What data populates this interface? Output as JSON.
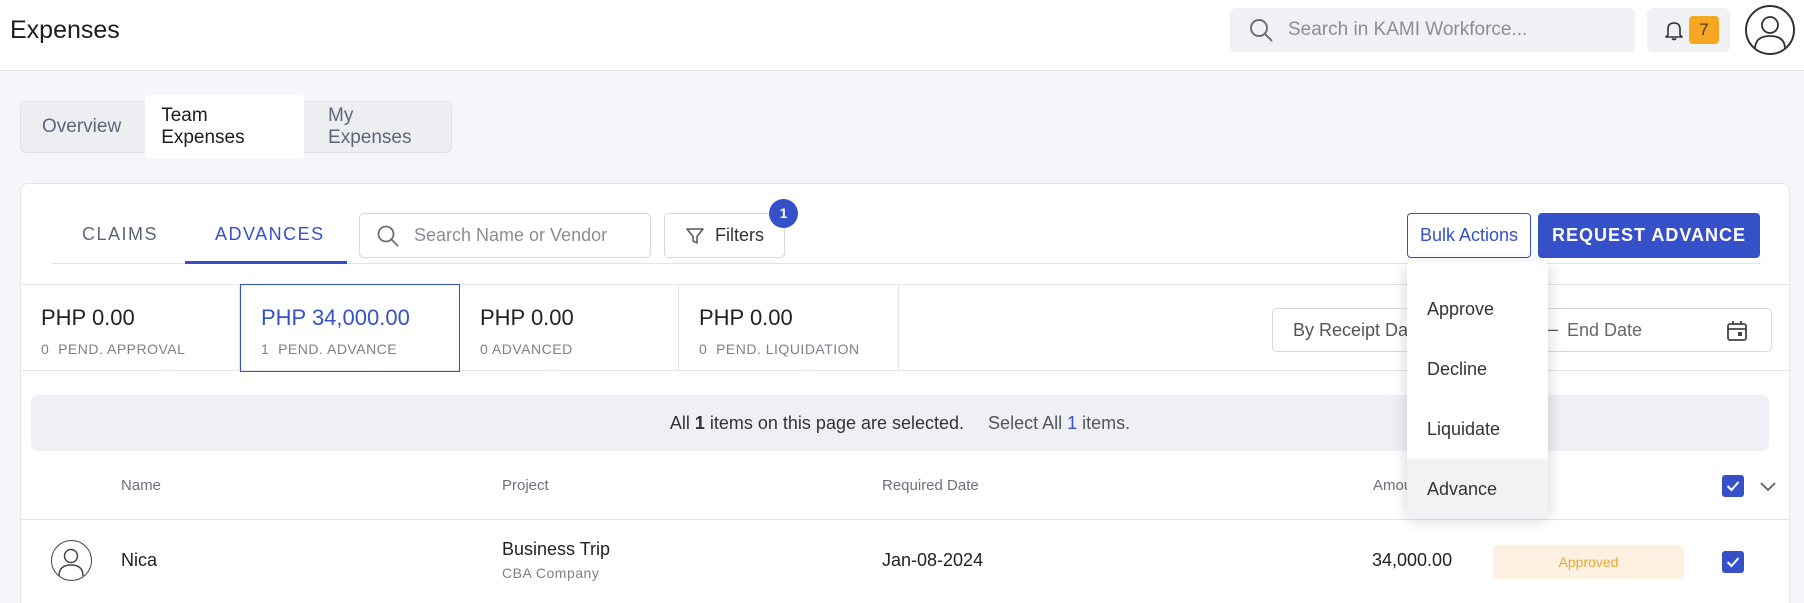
{
  "header": {
    "title": "Expenses",
    "search_placeholder": "Search in KAMI Workforce...",
    "notification_count": "7"
  },
  "main_tabs": [
    {
      "label": "Overview",
      "active": false
    },
    {
      "label": "Team Expenses",
      "active": true
    },
    {
      "label": "My Expenses",
      "active": false
    }
  ],
  "sub_tabs": [
    {
      "label": "CLAIMS",
      "active": false
    },
    {
      "label": "ADVANCES",
      "active": true
    }
  ],
  "toolbar": {
    "search_placeholder": "Search Name or Vendor",
    "filters_label": "Filters",
    "filters_count": "1",
    "bulk_actions_label": "Bulk Actions",
    "request_label": "REQUEST ADVANCE"
  },
  "summary": [
    {
      "amount": "PHP 0.00",
      "count": "0",
      "label": "PEND. APPROVAL",
      "selected": false
    },
    {
      "amount": "PHP 34,000.00",
      "count": "1",
      "label": "PEND. ADVANCE",
      "selected": true
    },
    {
      "amount": "PHP 0.00",
      "count": "0",
      "label": "ADVANCED",
      "selected": false
    },
    {
      "amount": "PHP 0.00",
      "count": "0",
      "label": "PEND. LIQUIDATION",
      "selected": false
    }
  ],
  "date_filter": {
    "start_label": "By Receipt Date",
    "separator": "–",
    "end_placeholder": "End Date"
  },
  "selection_banner": {
    "prefix": "All",
    "count": "1",
    "suffix": "items on this page are selected.",
    "select_all_prefix": "Select All",
    "select_all_count": "1",
    "select_all_suffix": "items."
  },
  "table": {
    "columns": [
      "Name",
      "Project",
      "Required Date",
      "Amount"
    ],
    "rows": [
      {
        "name": "Nica",
        "project": "Business Trip",
        "company": "CBA Company",
        "required_date": "Jan-08-2024",
        "amount": "34,000.00",
        "status": "Approved",
        "selected": true
      }
    ]
  },
  "bulk_menu": {
    "items": [
      "Approve",
      "Decline",
      "Liquidate",
      "Advance"
    ],
    "hovered": "Advance"
  },
  "colors": {
    "accent": "#3550c9",
    "badge": "#f5a623",
    "status_approved_bg": "#fdf1e1",
    "status_approved_text": "#e8a53a"
  }
}
